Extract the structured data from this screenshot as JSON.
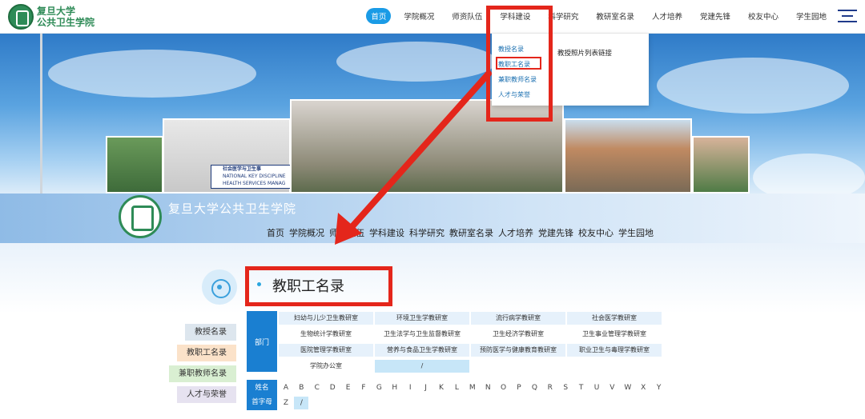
{
  "logo": {
    "line1": "复旦大学",
    "line2": "公共卫生学院"
  },
  "top_nav": [
    {
      "label": "首页",
      "active": true
    },
    {
      "label": "学院概况"
    },
    {
      "label": "师资队伍"
    },
    {
      "label": "学科建设"
    },
    {
      "label": "科学研究"
    },
    {
      "label": "教研室名录"
    },
    {
      "label": "人才培养"
    },
    {
      "label": "党建先锋"
    },
    {
      "label": "校友中心"
    },
    {
      "label": "学生园地"
    }
  ],
  "dropdown": {
    "items": [
      "教授名录",
      "教职工名录",
      "兼职教师名录",
      "人才与荣誉"
    ],
    "right_text": "教授照片列表链接"
  },
  "banner_sign": {
    "line1": "社会医学与卫生事",
    "line2": "NATIONAL KEY DISCIPLINE",
    "line3": "HEALTH SERVICES MANAG"
  },
  "header_strip": {
    "title": "复旦大学公共卫生学院"
  },
  "second_nav": [
    "首页",
    "学院概况",
    "师资队伍",
    "学科建设",
    "科学研究",
    "教研室名录",
    "人才培养",
    "党建先锋",
    "校友中心",
    "学生园地"
  ],
  "page_title": "教职工名录",
  "sidebar": [
    "教授名录",
    "教职工名录",
    "兼职教师名录",
    "人才与荣誉"
  ],
  "dept_label": "部门",
  "departments": [
    "妇幼与儿少卫生教研室",
    "环境卫生学教研室",
    "流行病学教研室",
    "社会医学教研室",
    "生物统计学教研室",
    "卫生法学与卫生监督教研室",
    "卫生经济学教研室",
    "卫生事业管理学教研室",
    "医院管理学教研室",
    "营养与食品卫生学教研室",
    "预防医学与健康教育教研室",
    "职业卫生与毒理学教研室",
    "学院办公室",
    "/"
  ],
  "letters_label": {
    "line1": "姓名",
    "line2": "首字母"
  },
  "letters_row1": [
    "A",
    "B",
    "C",
    "D",
    "E",
    "F",
    "G",
    "H",
    "I",
    "J",
    "K",
    "L",
    "M",
    "N",
    "O",
    "P",
    "Q",
    "R",
    "S",
    "T",
    "U",
    "V",
    "W",
    "X",
    "Y"
  ],
  "letters_row2": [
    "Z",
    "/"
  ],
  "colors": {
    "accent": "#1a9be6",
    "annotation_red": "#e4261b",
    "brand_green": "#2e8b57"
  }
}
